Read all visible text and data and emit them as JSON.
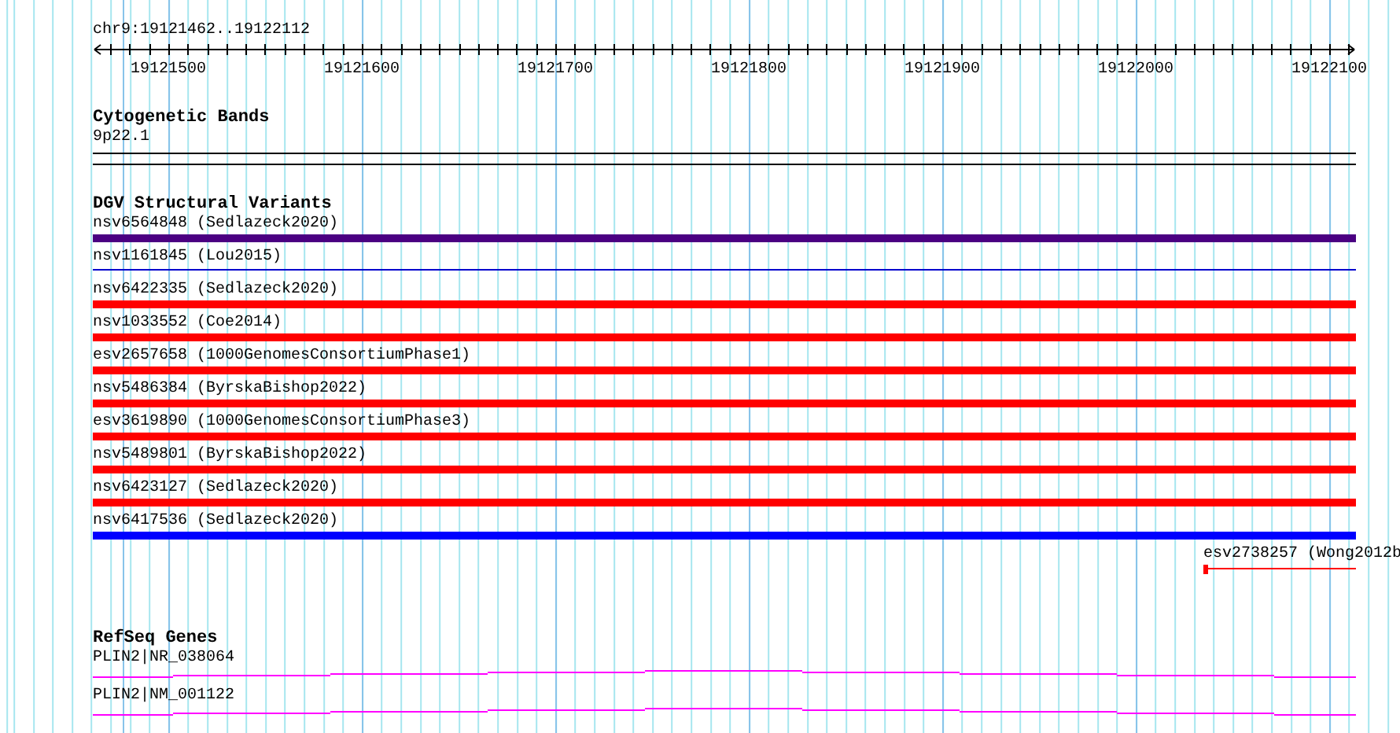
{
  "ruler": {
    "location": "chr9:19121462..19122112",
    "tick_labels": [
      "19121500",
      "19121600",
      "19121700",
      "19121800",
      "19121900",
      "19122000",
      "19122100"
    ]
  },
  "cytogenetic_bands": {
    "title": "Cytogenetic Bands",
    "features": [
      {
        "label": "9p22.1"
      }
    ]
  },
  "dgv_structural_variants": {
    "title": "DGV Structural Variants",
    "features": [
      {
        "label": "nsv6564848 (Sedlazeck2020)",
        "kind": "bar",
        "color": "#4b0082"
      },
      {
        "label": "nsv1161845 (Lou2015)",
        "kind": "line",
        "color": "#0000cd"
      },
      {
        "label": "nsv6422335 (Sedlazeck2020)",
        "kind": "bar",
        "color": "#ff0000"
      },
      {
        "label": "nsv1033552 (Coe2014)",
        "kind": "bar",
        "color": "#ff0000"
      },
      {
        "label": "esv2657658 (1000GenomesConsortiumPhase1)",
        "kind": "bar",
        "color": "#ff0000"
      },
      {
        "label": "nsv5486384 (ByrskaBishop2022)",
        "kind": "bar",
        "color": "#ff0000"
      },
      {
        "label": "esv3619890 (1000GenomesConsortiumPhase3)",
        "kind": "bar",
        "color": "#ff0000"
      },
      {
        "label": "nsv5489801 (ByrskaBishop2022)",
        "kind": "bar",
        "color": "#ff0000"
      },
      {
        "label": "nsv6423127 (Sedlazeck2020)",
        "kind": "bar",
        "color": "#ff0000"
      },
      {
        "label": "nsv6417536 (Sedlazeck2020)",
        "kind": "bar",
        "color": "#0000ff"
      },
      {
        "label": "esv2738257 (Wong2012b",
        "kind": "tail",
        "color": "#ff0000"
      }
    ]
  },
  "refseq_genes": {
    "title": "RefSeq Genes",
    "features": [
      {
        "label": "PLIN2|NR_038064"
      },
      {
        "label": "PLIN2|NM_001122"
      }
    ]
  }
}
